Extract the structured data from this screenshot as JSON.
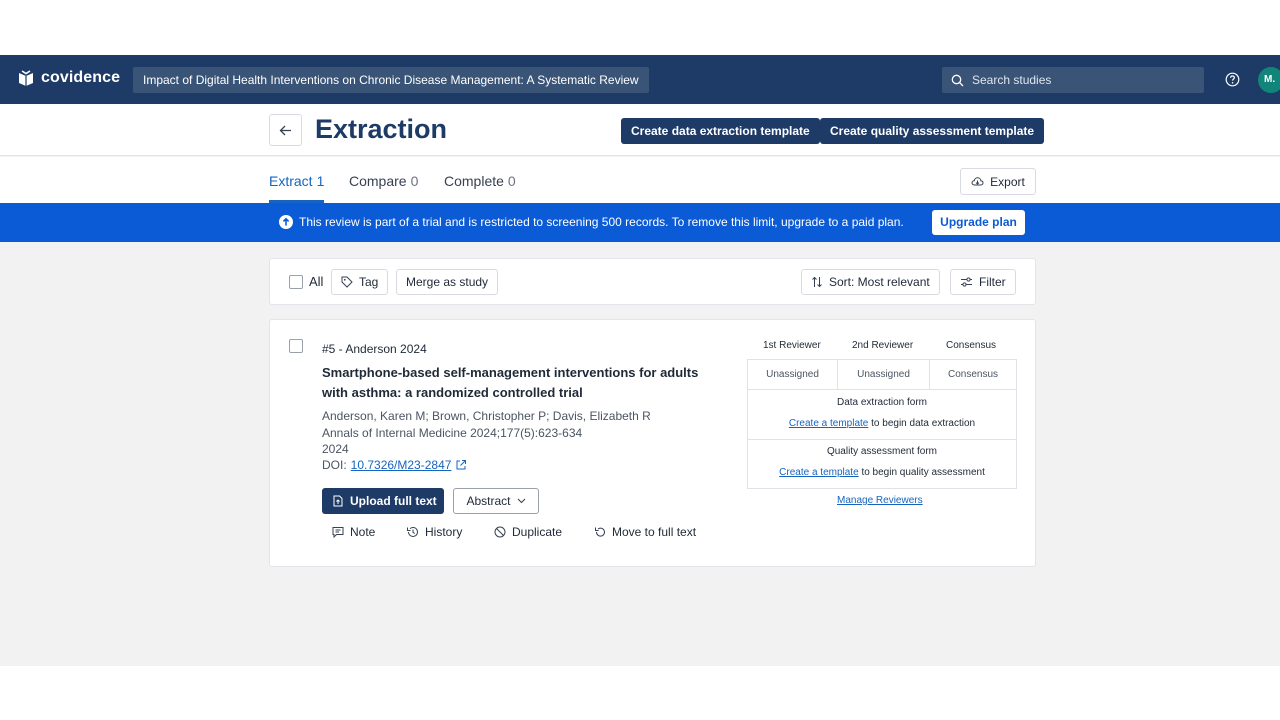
{
  "topbar": {
    "logo_text": "covidence",
    "review_title": "Impact of Digital Health Interventions on Chronic Disease Management: A Systematic Review",
    "search_placeholder": "Search studies",
    "avatar_initials": "M."
  },
  "header": {
    "title": "Extraction",
    "btn_extraction_template": "Create data extraction template",
    "btn_quality_template": "Create quality assessment template"
  },
  "tabs": [
    {
      "label": "Extract",
      "count": "1"
    },
    {
      "label": "Compare",
      "count": "0"
    },
    {
      "label": "Complete",
      "count": "0"
    }
  ],
  "export_label": "Export",
  "banner": {
    "text": "This review is part of a trial and is restricted to screening 500 records. To remove this limit, upgrade to a paid plan.",
    "upgrade_label": "Upgrade plan"
  },
  "toolbar": {
    "all_label": "All",
    "tag_label": "Tag",
    "merge_label": "Merge as study",
    "sort_label": "Sort: Most relevant",
    "filter_label": "Filter"
  },
  "study": {
    "id": "#5 - Anderson 2024",
    "title": "Smartphone-based self-management interventions for adults with asthma: a randomized controlled trial",
    "authors": "Anderson, Karen M; Brown, Christopher P; Davis, Elizabeth R",
    "journal": "Annals of Internal Medicine 2024;177(5):623-634",
    "year": "2024",
    "doi_prefix": "DOI:",
    "doi": "10.7326/M23-2847",
    "upload_label": "Upload full text",
    "abstract_label": "Abstract",
    "actions": {
      "note": "Note",
      "history": "History",
      "duplicate": "Duplicate",
      "move": "Move to full text"
    }
  },
  "reviewers": {
    "headers": [
      "1st Reviewer",
      "2nd Reviewer",
      "Consensus"
    ],
    "values": [
      "Unassigned",
      "Unassigned",
      "Consensus"
    ],
    "data_form_label": "Data extraction form",
    "data_form_link": "Create a template",
    "data_form_rest": "to begin data extraction",
    "quality_form_label": "Quality assessment form",
    "quality_form_link": "Create a template",
    "quality_form_rest": "to begin quality assessment",
    "manage_label": "Manage Reviewers"
  }
}
